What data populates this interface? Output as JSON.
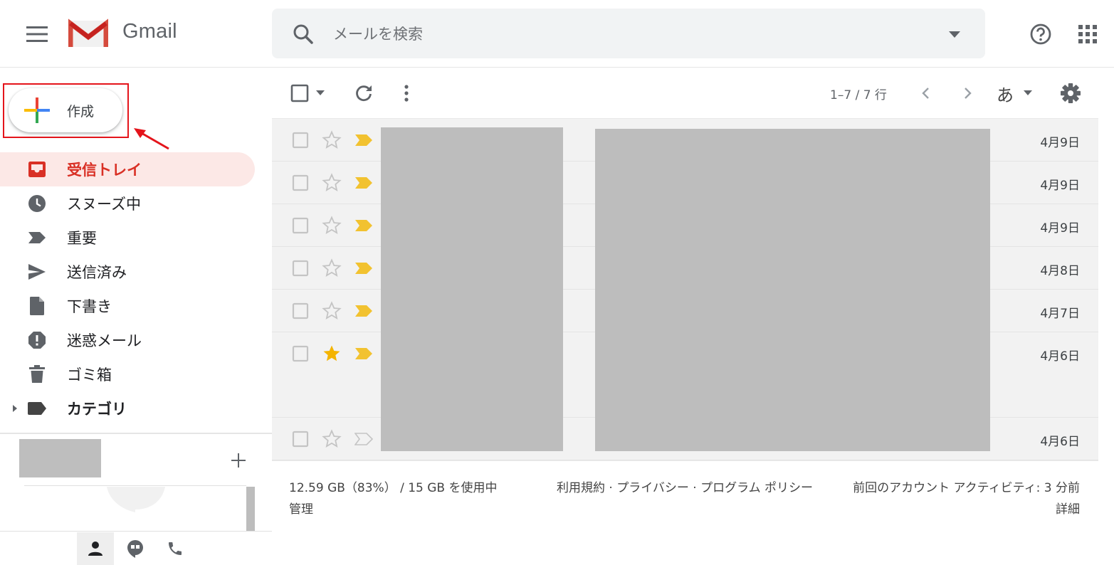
{
  "app": {
    "name": "Gmail"
  },
  "search": {
    "placeholder": "メールを検索"
  },
  "compose": {
    "label": "作成"
  },
  "nav": [
    {
      "id": "inbox",
      "label": "受信トレイ",
      "icon": "inbox-icon",
      "active": true
    },
    {
      "id": "snoozed",
      "label": "スヌーズ中",
      "icon": "clock-icon"
    },
    {
      "id": "important",
      "label": "重要",
      "icon": "important-icon"
    },
    {
      "id": "sent",
      "label": "送信済み",
      "icon": "send-icon"
    },
    {
      "id": "drafts",
      "label": "下書き",
      "icon": "draft-icon"
    },
    {
      "id": "spam",
      "label": "迷惑メール",
      "icon": "spam-icon"
    },
    {
      "id": "trash",
      "label": "ゴミ箱",
      "icon": "trash-icon"
    },
    {
      "id": "categories",
      "label": "カテゴリ",
      "icon": "label-icon",
      "bold": true
    }
  ],
  "toolbar": {
    "pagination": "1–7 / 7 行",
    "input_tool": "あ"
  },
  "emails": [
    {
      "date": "4月9日",
      "starred": false,
      "important": true
    },
    {
      "date": "4月9日",
      "starred": false,
      "important": true
    },
    {
      "date": "4月9日",
      "starred": false,
      "important": true
    },
    {
      "date": "4月8日",
      "starred": false,
      "important": true
    },
    {
      "date": "4月7日",
      "starred": false,
      "important": true
    },
    {
      "date": "4月6日",
      "starred": true,
      "important": true
    },
    {
      "date": "4月6日",
      "starred": false,
      "important": false
    }
  ],
  "footer": {
    "storage": "12.59 GB（83%） / 15 GB を使用中",
    "manage": "管理",
    "legal": "利用規約 · プライバシー · プログラム ポリシー",
    "activity": "前回のアカウント アクティビティ: 3 分前",
    "details": "詳細"
  },
  "colors": {
    "accent": "#d93025",
    "star": "#f4b400",
    "important": "#f2c230",
    "annotation": "#e4141b"
  }
}
